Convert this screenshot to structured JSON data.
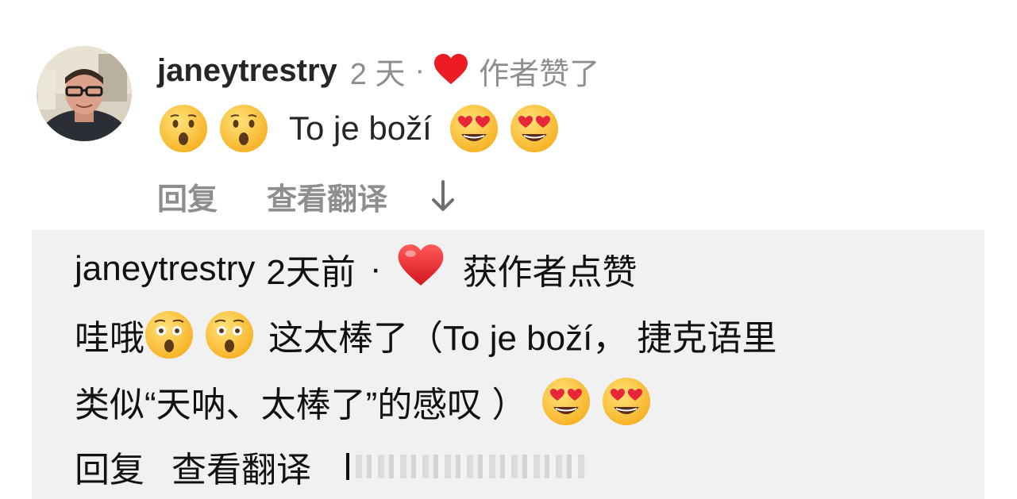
{
  "comment": {
    "username": "janeytrestry",
    "time": "2 天",
    "separator": "·",
    "liked_label": "作者赞了",
    "text": "To je boží",
    "leading_emojis": [
      "hushed-face-emoji",
      "hushed-face-emoji"
    ],
    "trailing_emojis": [
      "heart-eyes-emoji",
      "heart-eyes-emoji"
    ],
    "actions": {
      "reply": "回复",
      "translate": "查看翻译"
    },
    "heart_color": "#ed1c24"
  },
  "translation": {
    "header": {
      "username": "janeytrestry",
      "time": "2天前",
      "separator": "·",
      "liked_label": "获作者点赞"
    },
    "line1_prefix": "哇哦",
    "line1_suffix": "这太棒了（To je boží， 捷克语里",
    "line2_text": "类似“天呐、太棒了”的感叹 ）",
    "actions": {
      "reply": "回复",
      "translate": "查看翻译"
    },
    "panel_bg": "#f1f1f1"
  },
  "colors": {
    "muted_text": "#8e8e8e",
    "primary_text": "#262626",
    "emoji_yellow": "#ffcb4c"
  }
}
